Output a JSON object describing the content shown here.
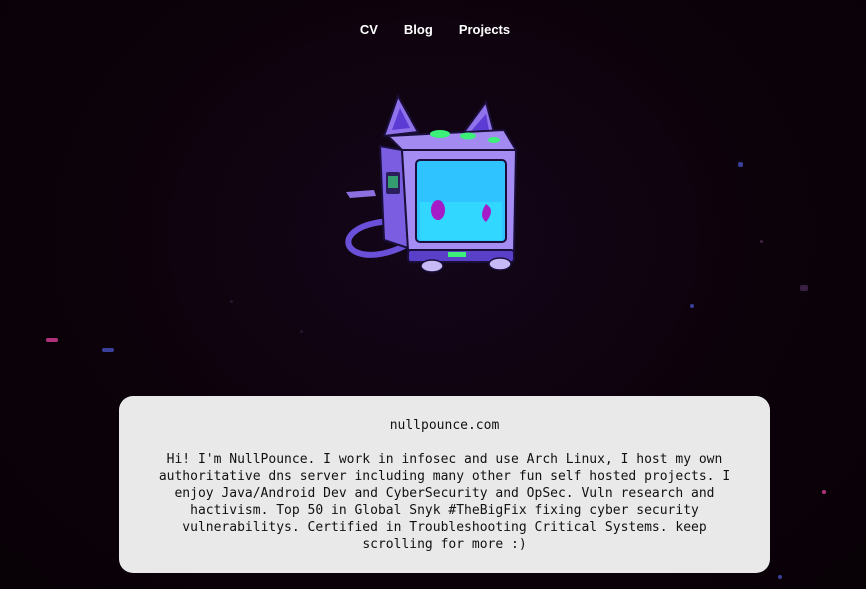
{
  "nav": {
    "items": [
      {
        "label": "CV"
      },
      {
        "label": "Blog"
      },
      {
        "label": "Projects"
      }
    ]
  },
  "hero": {
    "image_name": "robot-cat-mascot",
    "colors": {
      "background": "#0c020a",
      "body": "#9b7cf0",
      "screen": "#33c8ff",
      "accent": "#3cf07a",
      "eyes": "#a31cc7"
    }
  },
  "card": {
    "site": "nullpounce.com",
    "bio": "Hi! I'm NullPounce. I work in infosec and use Arch Linux, I host my own authoritative dns server including many other fun self hosted projects. I enjoy Java/Android Dev and CyberSecurity and OpSec. Vuln research and hactivism. Top 50 in Global Snyk #TheBigFix fixing cyber security vulnerabilitys. Certified in Troubleshooting Critical Systems. keep scrolling for more :)",
    "background": "#e9e9e9"
  }
}
